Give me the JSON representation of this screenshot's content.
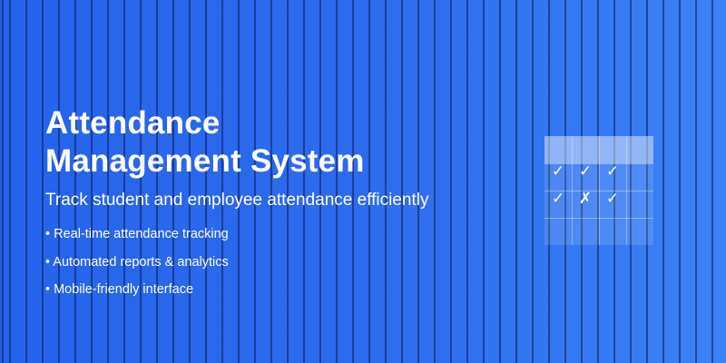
{
  "title_line1": "Attendance",
  "title_line2": "Management System",
  "subtitle": "Track student and employee attendance efficiently",
  "features": [
    "• Real-time attendance tracking",
    "• Automated reports & analytics",
    "• Mobile-friendly interface"
  ],
  "calendar": {
    "row1": [
      "✓",
      "✓",
      "✓"
    ],
    "row2": [
      "✓",
      "✗",
      "✓"
    ]
  },
  "colors": {
    "background_start": "#2563eb",
    "background_end": "#3b82f6",
    "text": "#ffffff"
  }
}
